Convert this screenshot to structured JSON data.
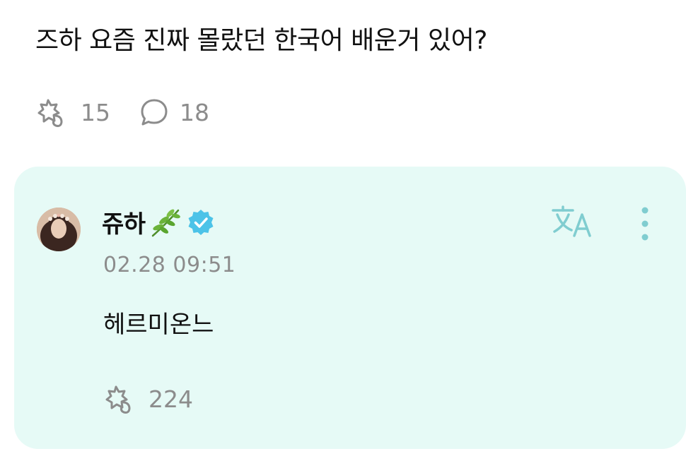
{
  "post": {
    "text": "즈하 요즘 진짜 몰랐던 한국어 배운거 있어?",
    "like_count": "15",
    "comment_count": "18"
  },
  "reply": {
    "author_name": "쥬하",
    "timestamp": "02.28 09:51",
    "text": "헤르미온느",
    "like_count": "224"
  },
  "icons": {
    "like": "flower-like-icon",
    "comment": "speech-bubble-icon",
    "translate": "translate-icon",
    "more": "more-vertical-icon",
    "verified": "verified-badge-icon",
    "leaf": "herb-leaf-icon"
  },
  "colors": {
    "card_background": "#e6faf6",
    "muted_text": "#8c8c8c",
    "verified": "#4cc3e8",
    "icon_teal": "#80cdd0"
  }
}
